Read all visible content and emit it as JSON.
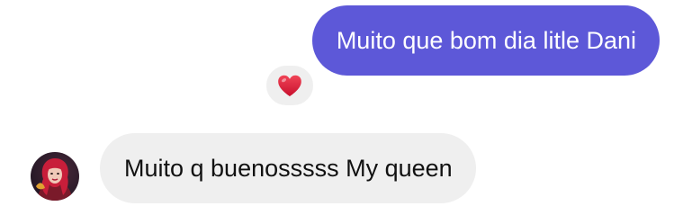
{
  "messages": [
    {
      "direction": "outgoing",
      "text": "Muito que bom dia litle Dani",
      "bubble_color": "#5d58d8",
      "reaction": {
        "icon": "red-heart-icon",
        "color": "#e0243a"
      }
    },
    {
      "direction": "incoming",
      "text": "Muito q buenosssss My queen",
      "bubble_color": "#efefef",
      "sender_avatar": "avatar-photo"
    }
  ]
}
